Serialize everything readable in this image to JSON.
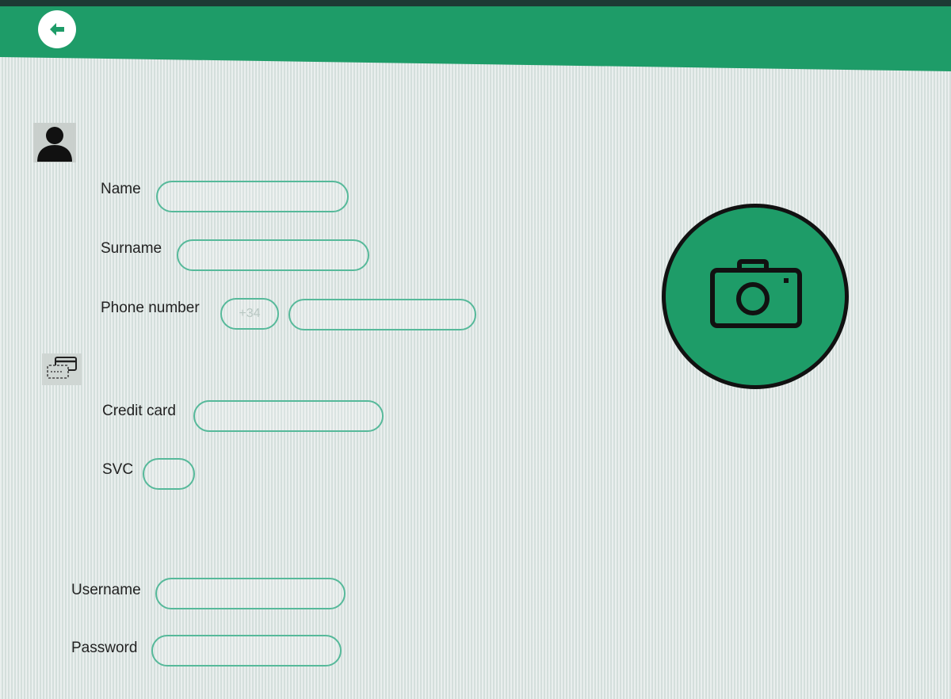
{
  "header": {
    "back_icon": "arrow-left-icon",
    "color": "#1e9c68"
  },
  "personal": {
    "icon": "user-icon",
    "name_label": "Name",
    "surname_label": "Surname",
    "phone_label": "Phone number",
    "phone_prefix_placeholder": "+34"
  },
  "payment": {
    "icon": "credit-card-icon",
    "credit_card_label": "Credit card",
    "svc_label": "SVC"
  },
  "account": {
    "username_label": "Username",
    "password_label": "Password"
  },
  "photo": {
    "icon": "camera-icon",
    "color": "#1e9c68"
  }
}
